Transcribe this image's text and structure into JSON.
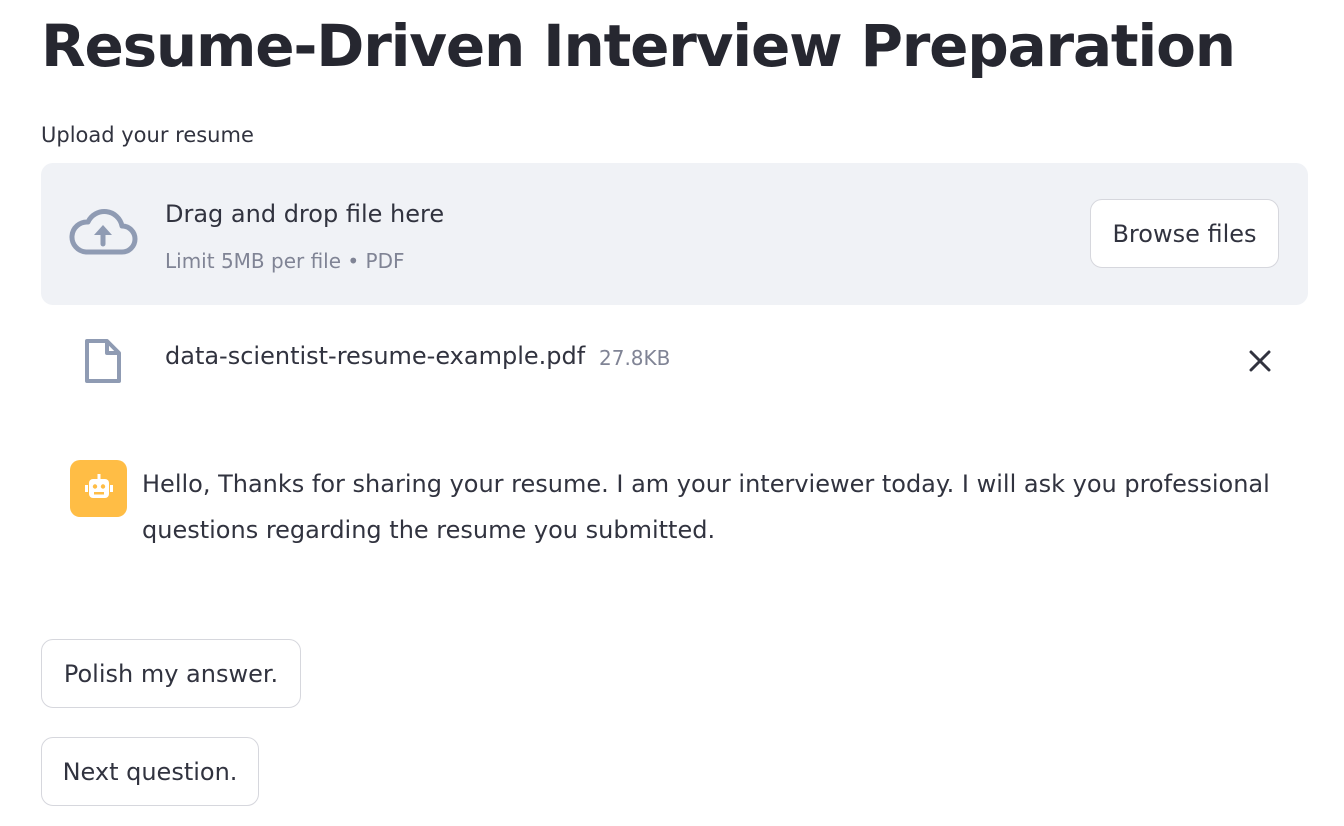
{
  "page": {
    "title": "Resume-Driven Interview Preparation"
  },
  "uploader": {
    "label": "Upload your resume",
    "drop_text": "Drag and drop file here",
    "limit_text": "Limit 5MB per file • PDF",
    "browse_label": "Browse files",
    "icon": "cloud-upload-icon"
  },
  "uploaded_file": {
    "name": "data-scientist-resume-example.pdf",
    "size": "27.8KB",
    "icon": "file-icon",
    "remove_icon": "close-icon"
  },
  "chat": {
    "avatar_icon": "robot-icon",
    "avatar_color": "#ffbd45",
    "message": "Hello, Thanks for sharing your resume. I am your interviewer today. I will ask you professional questions regarding the resume you submitted."
  },
  "actions": {
    "polish_label": "Polish my answer.",
    "next_label": "Next question."
  },
  "colors": {
    "text": "#31333f",
    "muted": "#808495",
    "dropzone_bg": "#f0f2f6",
    "button_border": "#d6d7dd",
    "icon_slate": "#8f9bb3"
  }
}
